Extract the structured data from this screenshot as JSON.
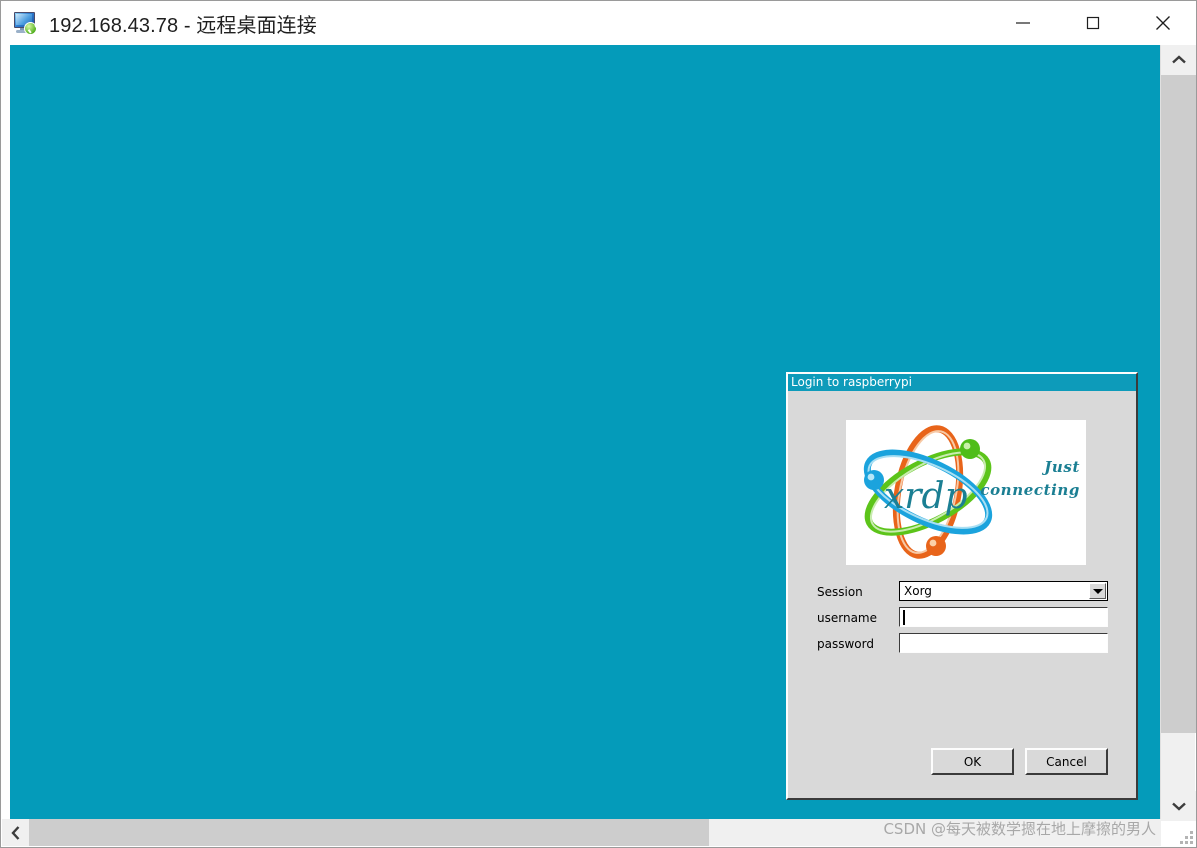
{
  "window": {
    "title": "192.168.43.78 - 远程桌面连接",
    "icon": "remote-desktop-icon",
    "controls": {
      "minimize": "—",
      "maximize": "□",
      "close": "✕"
    }
  },
  "desktop": {
    "background_color": "#049BBA"
  },
  "login_dialog": {
    "title": "Login to raspberrypi",
    "titlebar_color": "#0d9bba",
    "body_color": "#d9d9d9",
    "logo": {
      "wordmark": "xrdp",
      "tagline_line1": "Just",
      "tagline_line2": "connecting",
      "tagline_color": "#1b7f93",
      "ring_colors": [
        "#e8641a",
        "#5cc41a",
        "#1ba3dd"
      ]
    },
    "fields": [
      {
        "label": "Session",
        "type": "select",
        "value": "Xorg",
        "options": [
          "Xorg"
        ],
        "name": "session-select"
      },
      {
        "label": "username",
        "type": "text",
        "value": "",
        "placeholder": "",
        "focused": true,
        "name": "username-input"
      },
      {
        "label": "password",
        "type": "password",
        "value": "",
        "placeholder": "",
        "focused": false,
        "name": "password-input"
      }
    ],
    "buttons": {
      "ok": "OK",
      "cancel": "Cancel"
    }
  },
  "scrollbars": {
    "vertical": {
      "up_arrow": "⌃",
      "down_arrow": "⌄"
    },
    "horizontal": {
      "left_arrow": "❮"
    }
  },
  "watermark": "CSDN @每天被数学摁在地上摩擦的男人"
}
